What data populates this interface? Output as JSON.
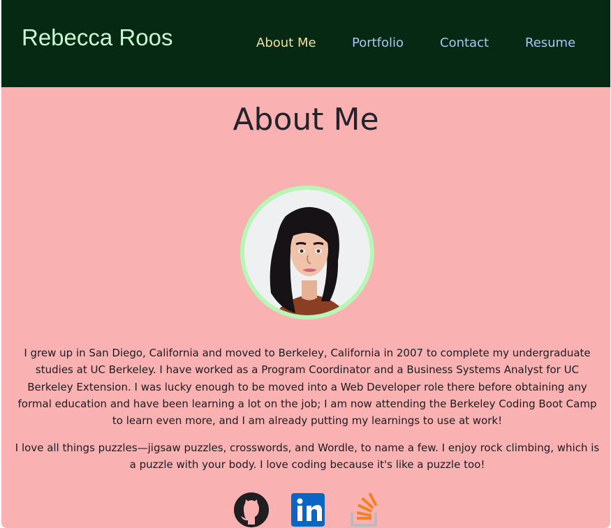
{
  "navbar": {
    "brand": "Rebecca Roos",
    "links": [
      {
        "label": "About Me",
        "active": true
      },
      {
        "label": "Portfolio",
        "active": false
      },
      {
        "label": "Contact",
        "active": false
      },
      {
        "label": "Resume",
        "active": false
      }
    ]
  },
  "main": {
    "title": "About Me",
    "bio": [
      "I grew up in San Diego, California and moved to Berkeley, California in 2007 to complete my undergraduate studies at UC Berkeley. I have worked as a Program Coordinator and a Business Systems Analyst for UC Berkeley Extension. I was lucky enough to be moved into a Web Developer role there before obtaining any formal education and have been learning a lot on the job; I am now attending the Berkeley Coding Boot Camp to learn even more, and I am already putting my learnings to use at work!",
      "I love all things puzzles—jigsaw puzzles, crosswords, and Wordle, to name a few. I enjoy rock climbing, which is a puzzle with your body. I love coding because it's like a puzzle too!"
    ],
    "social_icons": [
      "github-icon",
      "linkedin-icon",
      "stack-overflow-icon"
    ]
  },
  "colors": {
    "navbar_bg": "#062913",
    "page_bg": "#f9b1b1",
    "brand": "#c7f7d3",
    "active_link": "#f3dfa2",
    "link": "#a9c7f5",
    "avatar_ring": "#b7f6b5"
  }
}
